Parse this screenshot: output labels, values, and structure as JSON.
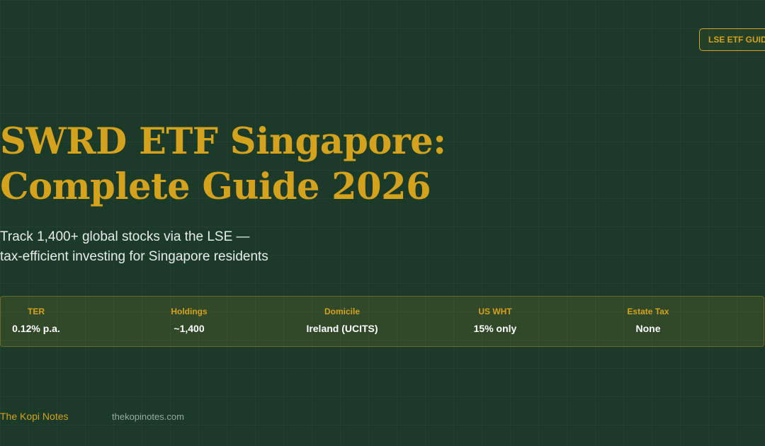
{
  "badge": {
    "label": "LSE ETF GUIDE"
  },
  "title": {
    "line1": "SWRD ETF Singapore:",
    "line2": "Complete Guide 2026"
  },
  "subtitle": {
    "line1": "Track 1,400+ global stocks via the LSE —",
    "line2": "tax-efficient investing for Singapore residents"
  },
  "stats": [
    {
      "label": "TER",
      "value": "0.12% p.a."
    },
    {
      "label": "Holdings",
      "value": "~1,400"
    },
    {
      "label": "Domicile",
      "value": "Ireland (UCITS)"
    },
    {
      "label": "US WHT",
      "value": "15% only"
    },
    {
      "label": "Estate Tax",
      "value": "None"
    }
  ],
  "footer": {
    "brand": "The Kopi Notes",
    "url": "thekopinotes.com"
  },
  "colors": {
    "background": "#1b3a2a",
    "accent": "#d4a21c",
    "text": "#ffffff"
  }
}
